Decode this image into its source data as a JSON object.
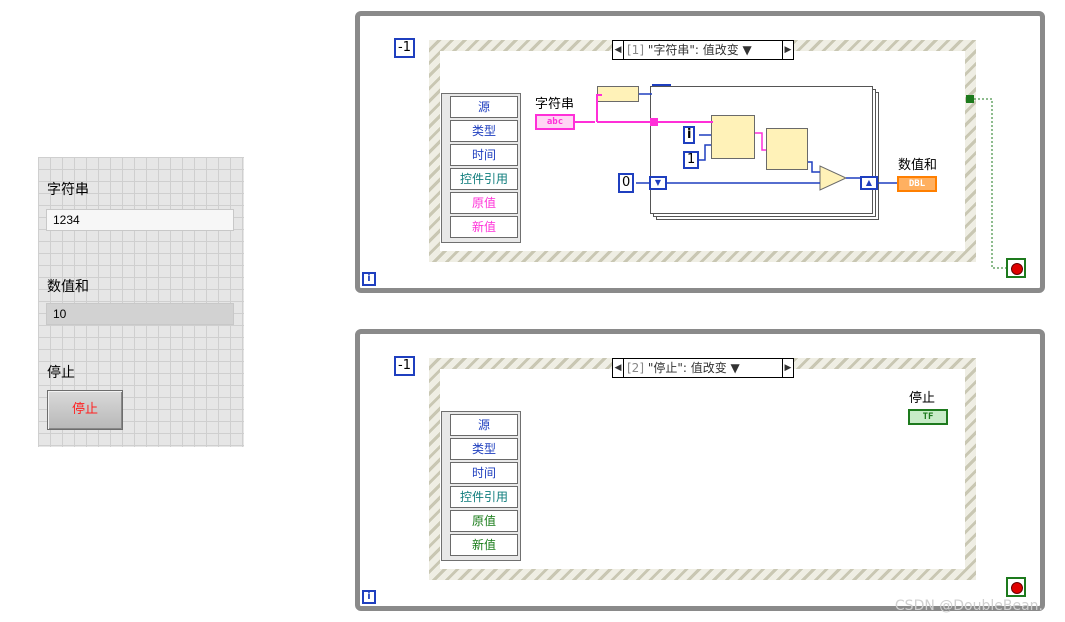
{
  "front_panel": {
    "string_label": "字符串",
    "string_value": "1234",
    "sum_label": "数值和",
    "sum_value": "10",
    "stop_label": "停止",
    "stop_button": "停止"
  },
  "loop1": {
    "timeout_const": "-1",
    "case_index": "[1]",
    "case_title": "\"字符串\": 值改变",
    "node_rows": [
      "源",
      "类型",
      "时间",
      "控件引用",
      "原值",
      "新值"
    ],
    "string_terminal_label": "字符串",
    "string_terminal_type": "abc",
    "for_count": "N",
    "const_i": "i",
    "const_one": "1",
    "const_zero": "0",
    "sum_terminal_label": "数值和",
    "sum_terminal_type": "DBL",
    "add_symbol": "+",
    "iteration": "i"
  },
  "loop2": {
    "timeout_const": "-1",
    "case_index": "[2]",
    "case_title": "\"停止\": 值改变",
    "node_rows": [
      "源",
      "类型",
      "时间",
      "控件引用",
      "原值",
      "新值"
    ],
    "stop_terminal_label": "停止",
    "stop_terminal_type": "TF",
    "iteration": "i"
  },
  "watermark": "CSDN @DoubleBean."
}
